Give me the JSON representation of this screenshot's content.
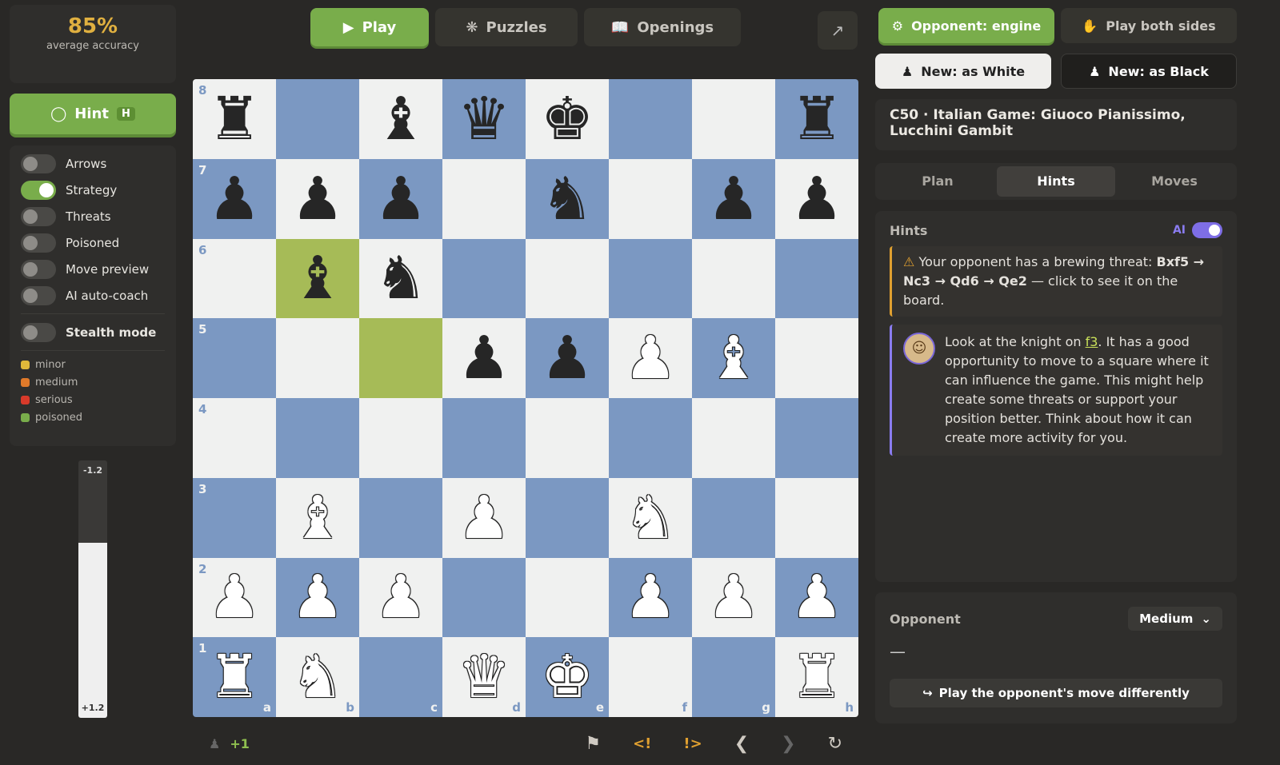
{
  "accuracy": {
    "value": "85%",
    "label": "average accuracy"
  },
  "hint_button": {
    "label": "Hint",
    "shortcut": "H"
  },
  "toggles": [
    {
      "label": "Arrows",
      "on": false
    },
    {
      "label": "Strategy",
      "on": true
    },
    {
      "label": "Threats",
      "on": false
    },
    {
      "label": "Poisoned",
      "on": false
    },
    {
      "label": "Move preview",
      "on": false
    },
    {
      "label": "AI auto-coach",
      "on": false
    }
  ],
  "stealth": {
    "label": "Stealth mode",
    "on": false
  },
  "legend": [
    {
      "label": "minor",
      "color": "#e0b83a"
    },
    {
      "label": "medium",
      "color": "#e07a2a"
    },
    {
      "label": "serious",
      "color": "#d83a2a"
    },
    {
      "label": "poisoned",
      "color": "#79ad4b"
    }
  ],
  "eval": {
    "top": "-1.2",
    "bottom": "+1.2",
    "white_fraction": 0.68
  },
  "nav": {
    "play": "Play",
    "puzzles": "Puzzles",
    "openings": "Openings"
  },
  "board": {
    "ranks": [
      "8",
      "7",
      "6",
      "5",
      "4",
      "3",
      "2",
      "1"
    ],
    "files": [
      "a",
      "b",
      "c",
      "d",
      "e",
      "f",
      "g",
      "h"
    ],
    "highlighted": [
      "b6",
      "c5"
    ],
    "pieces": {
      "a8": "br",
      "c8": "bb",
      "d8": "bq",
      "e8": "bk",
      "h8": "br",
      "a7": "bp",
      "b7": "bp",
      "c7": "bp",
      "e7": "bn",
      "g7": "bp",
      "h7": "bp",
      "b6": "bb",
      "c6": "bn",
      "d5": "bp",
      "e5": "bp",
      "f5": "wp",
      "g5": "wb",
      "b3": "wb",
      "d3": "wp",
      "f3": "wn",
      "a2": "wp",
      "b2": "wp",
      "c2": "wp",
      "f2": "wp",
      "g2": "wp",
      "h2": "wp",
      "a1": "wr",
      "b1": "wn",
      "d1": "wq",
      "e1": "wk",
      "h1": "wr"
    }
  },
  "material": "+1",
  "controls": [
    "flag-icon",
    "prev-mistake",
    "prev-good",
    "back",
    "forward",
    "flip"
  ],
  "opponent_mode": {
    "engine": "Opponent: engine",
    "both": "Play both sides"
  },
  "new_game": {
    "white": "New: as White",
    "black": "New: as Black"
  },
  "opening": "C50 · Italian Game: Giuoco Pianissimo, Lucchini Gambit",
  "tabs": [
    "Plan",
    "Hints",
    "Moves"
  ],
  "hints": {
    "title": "Hints",
    "ai_label": "AI",
    "threat_prefix": "Your opponent has a brewing threat: ",
    "threat_line": "Bxf5 → Nc3 → Qd6 → Qe2",
    "threat_suffix": " — click to see it on the board.",
    "coach_a": "Look at the knight on ",
    "coach_sq": "f3",
    "coach_b": ". It has a good opportunity to move to a square where it can influence the game. This might help create some threats or support your position better. Think about how it can create more activity for you."
  },
  "opponent": {
    "label": "Opponent",
    "level": "Medium",
    "last_move": "—",
    "replay": "Play the opponent's move differently"
  }
}
